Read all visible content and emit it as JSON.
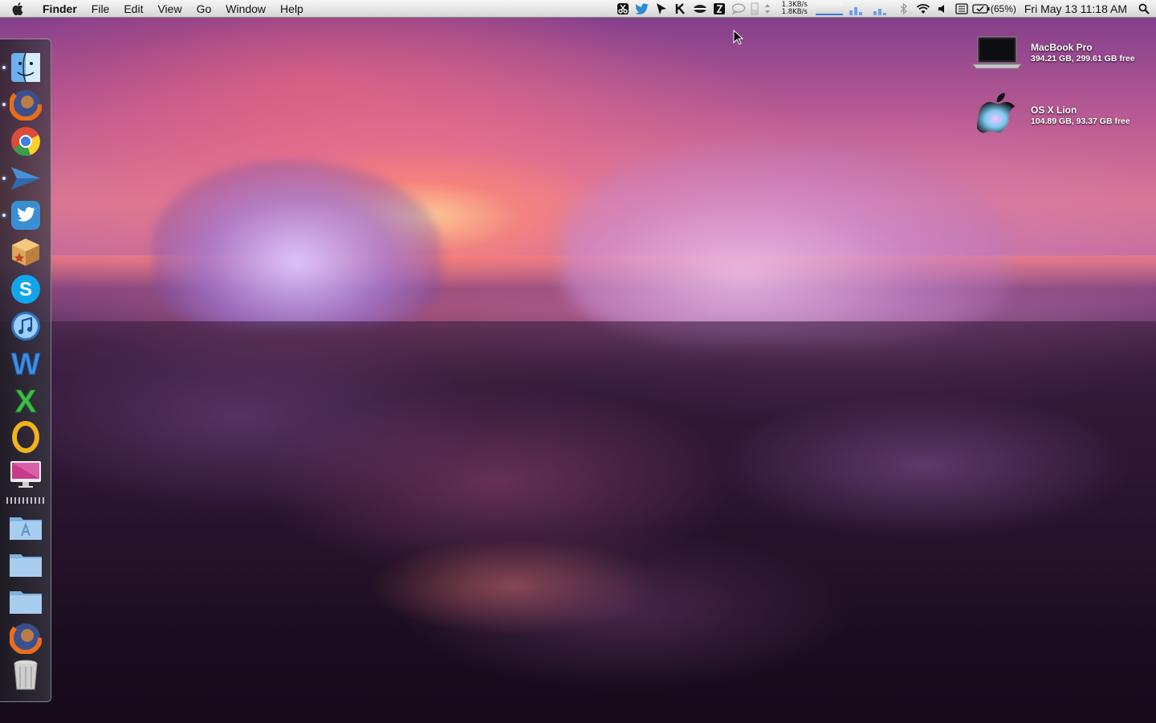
{
  "menubar": {
    "app_name": "Finder",
    "menus": [
      "File",
      "Edit",
      "View",
      "Go",
      "Window",
      "Help"
    ],
    "netspeed": {
      "up": "1.3KB/s",
      "down": "1.8KB/s"
    },
    "battery_percent": "(65%)",
    "datetime": "Fri May 13  11:18 AM"
  },
  "dock": {
    "items": [
      {
        "name": "finder",
        "running": true
      },
      {
        "name": "firefox",
        "running": true
      },
      {
        "name": "chrome",
        "running": false
      },
      {
        "name": "sparrow-mail",
        "running": true
      },
      {
        "name": "twitter",
        "running": true
      },
      {
        "name": "package-app",
        "running": false
      },
      {
        "name": "skype",
        "running": false
      },
      {
        "name": "itunes",
        "running": false
      },
      {
        "name": "word-app",
        "running": false
      },
      {
        "name": "excel-app",
        "running": false
      },
      {
        "name": "openoffice",
        "running": false
      },
      {
        "name": "imac-display",
        "running": false
      },
      {
        "name": "applications-folder",
        "running": false
      },
      {
        "name": "documents-folder",
        "running": false
      },
      {
        "name": "downloads-folder",
        "running": false
      },
      {
        "name": "firefox-stack",
        "running": false
      },
      {
        "name": "trash",
        "running": false
      }
    ]
  },
  "drives": [
    {
      "name": "MacBook Pro",
      "info": "394.21 GB, 299.61 GB free"
    },
    {
      "name": "OS X Lion",
      "info": "104.89 GB, 93.37 GB free"
    }
  ],
  "colors": {
    "menubar_bg": "#e6e6e6",
    "wallpaper_sky": "#c06a9a",
    "wallpaper_rocks": "#2c1730"
  }
}
